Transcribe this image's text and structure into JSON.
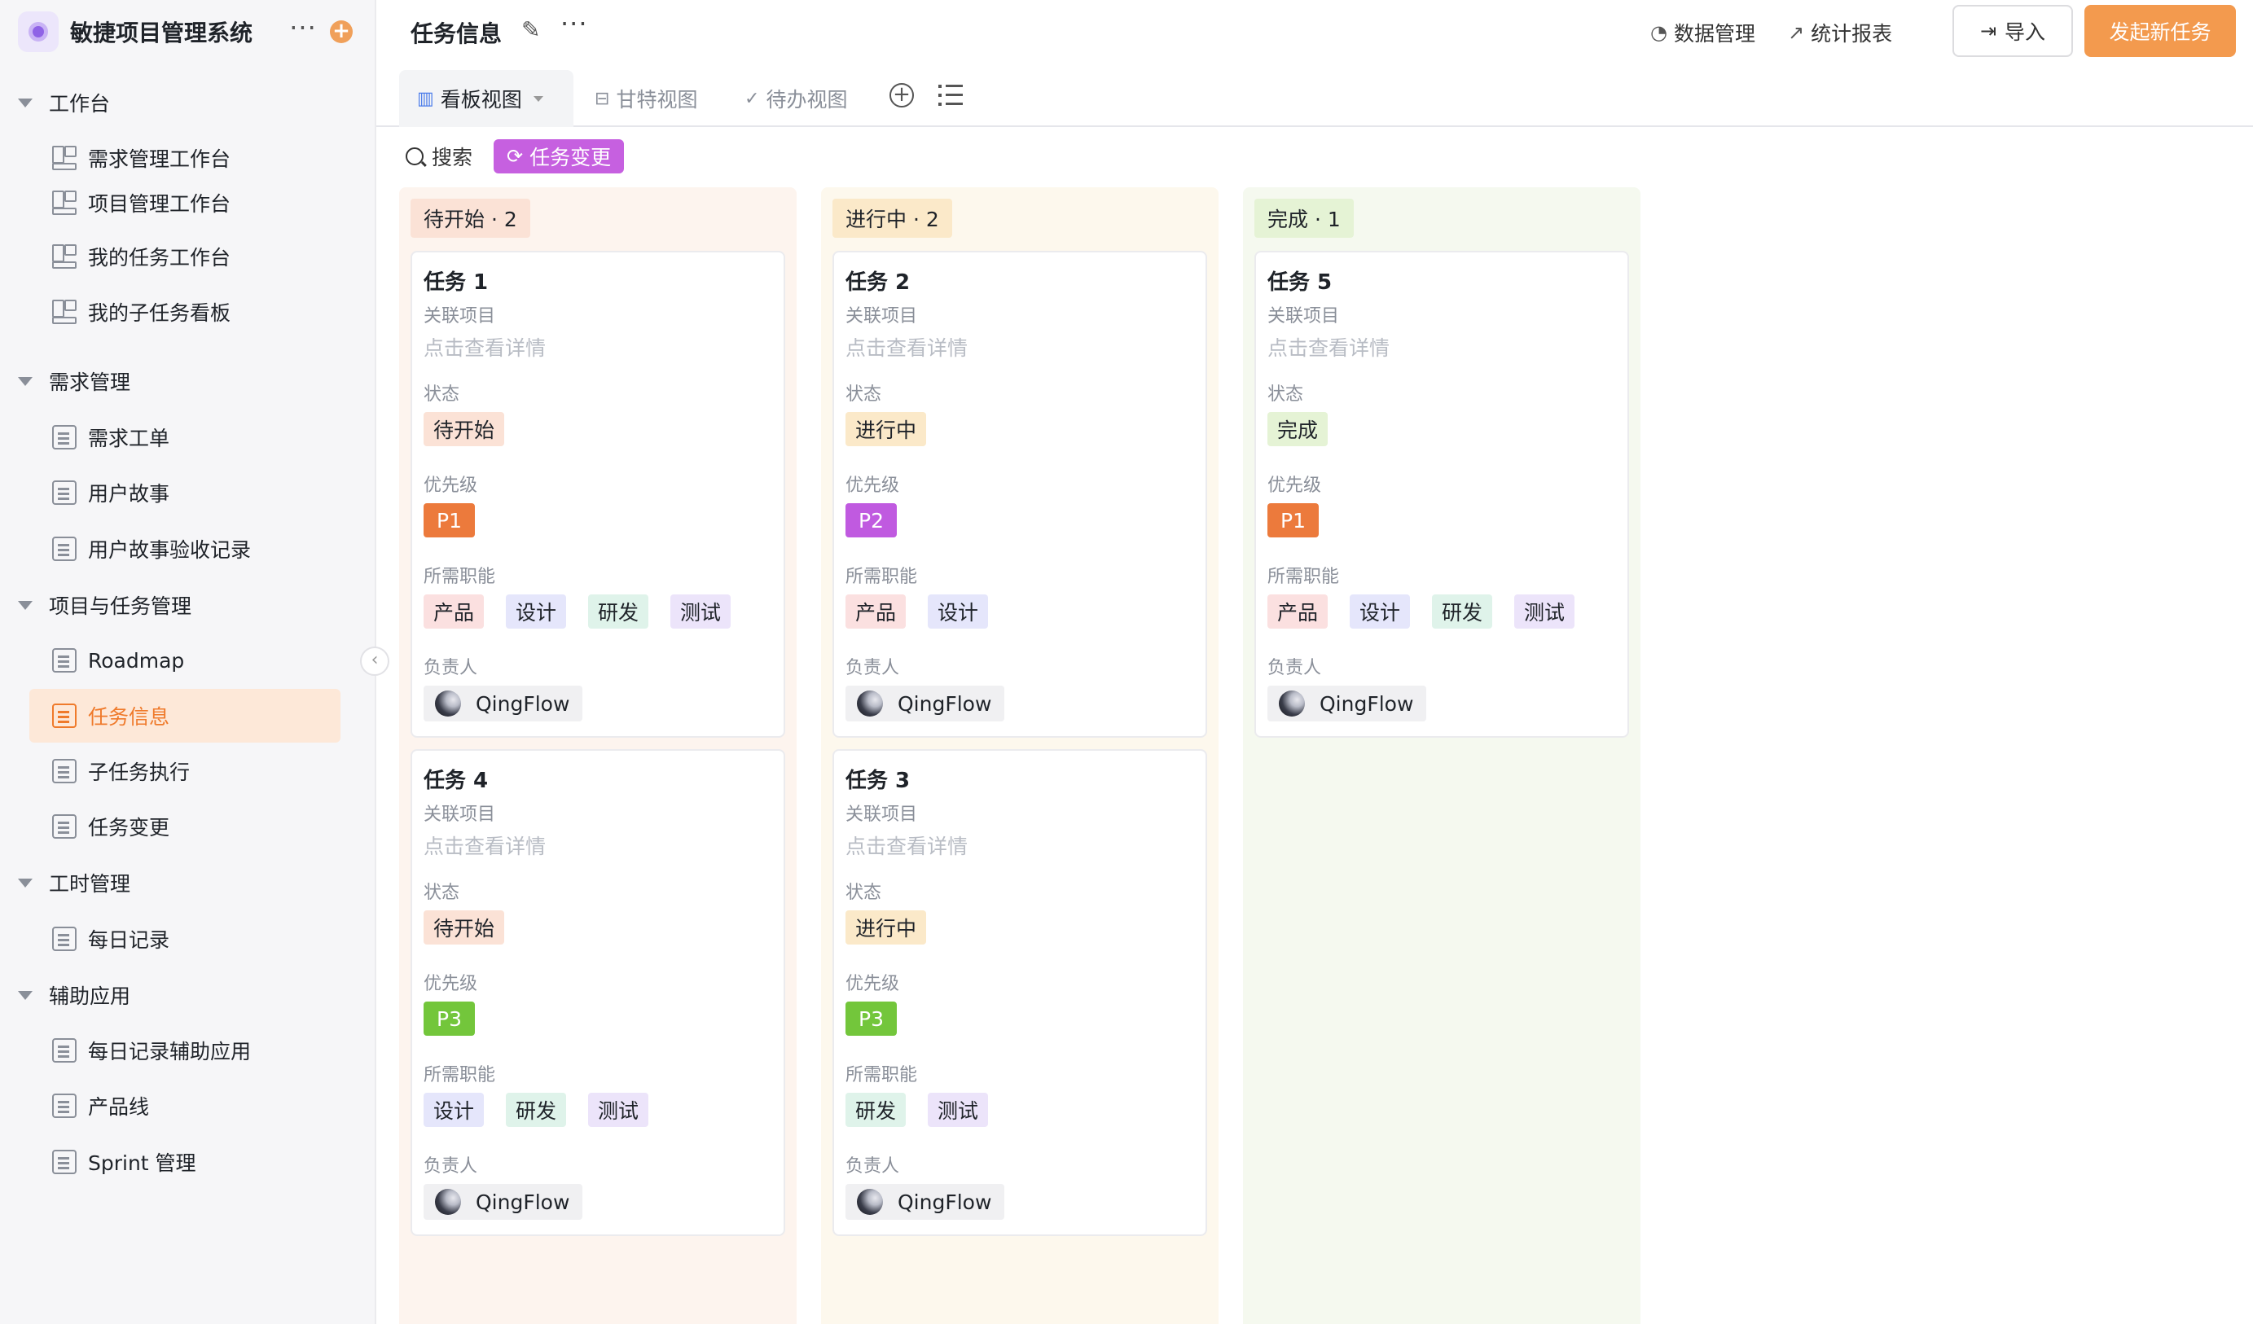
{
  "app": {
    "title": "敏捷项目管理系统"
  },
  "sidebar": {
    "groups": [
      {
        "label": "工作台",
        "items": [
          "需求管理工作台",
          "项目管理工作台",
          "我的任务工作台",
          "我的子任务看板"
        ]
      },
      {
        "label": "需求管理",
        "items": [
          "需求工单",
          "用户故事",
          "用户故事验收记录"
        ]
      },
      {
        "label": "项目与任务管理",
        "items": [
          "Roadmap",
          "任务信息",
          "子任务执行",
          "任务变更"
        ]
      },
      {
        "label": "工时管理",
        "items": [
          "每日记录"
        ]
      },
      {
        "label": "辅助应用",
        "items": [
          "每日记录辅助应用",
          "产品线",
          "Sprint 管理"
        ]
      }
    ],
    "active_item": "任务信息"
  },
  "header": {
    "title": "任务信息",
    "data_mgmt": "数据管理",
    "reports": "统计报表",
    "import_label": "导入",
    "new_task_label": "发起新任务"
  },
  "tabs": [
    "看板视图",
    "甘特视图",
    "待办视图"
  ],
  "toolbar": {
    "search": "搜索",
    "filter_chip": "任务变更"
  },
  "colors": {
    "accent": "#f39a4e",
    "chip_purple": "#c660e0",
    "p1": "#ec7a3c",
    "p2": "#c05ae0",
    "p3": "#73c63b"
  },
  "labels": {
    "project": "关联项目",
    "detail_link": "点击查看详情",
    "status": "状态",
    "priority": "优先级",
    "roles": "所需职能",
    "owner": "负责人"
  },
  "columns": [
    {
      "header": "待开始 · 2",
      "cards": [
        {
          "title": "任务 1",
          "status": "待开始",
          "priority": "P1",
          "roles": [
            "产品",
            "设计",
            "研发",
            "测试"
          ],
          "owner": "QingFlow"
        },
        {
          "title": "任务 4",
          "status": "待开始",
          "priority": "P3",
          "roles": [
            "设计",
            "研发",
            "测试"
          ],
          "owner": "QingFlow"
        }
      ]
    },
    {
      "header": "进行中 · 2",
      "cards": [
        {
          "title": "任务 2",
          "status": "进行中",
          "priority": "P2",
          "roles": [
            "产品",
            "设计"
          ],
          "owner": "QingFlow"
        },
        {
          "title": "任务 3",
          "status": "进行中",
          "priority": "P3",
          "roles": [
            "研发",
            "测试"
          ],
          "owner": "QingFlow"
        }
      ]
    },
    {
      "header": "完成 · 1",
      "cards": [
        {
          "title": "任务 5",
          "status": "完成",
          "priority": "P1",
          "roles": [
            "产品",
            "设计",
            "研发",
            "测试"
          ],
          "owner": "QingFlow"
        }
      ]
    }
  ]
}
